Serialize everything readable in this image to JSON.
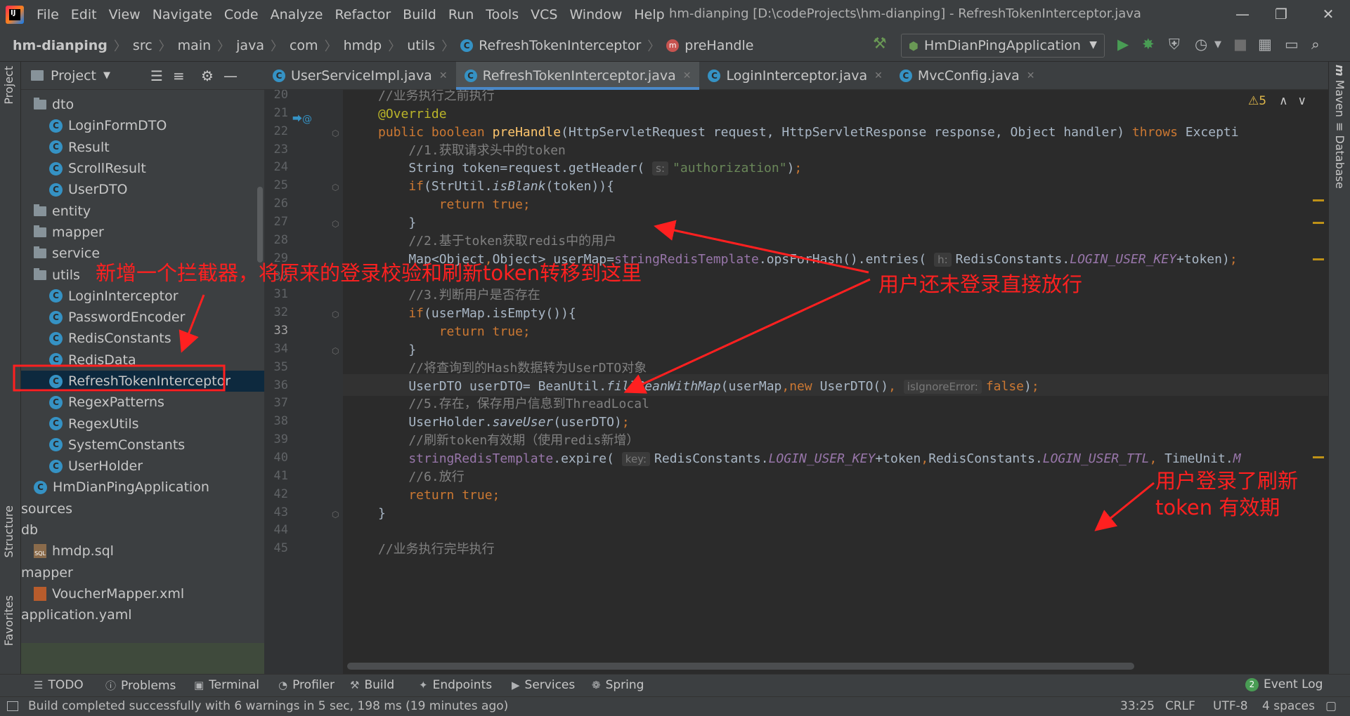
{
  "app": {
    "window_title": "hm-dianping [D:\\codeProjects\\hm-dianping] - RefreshTokenInterceptor.java",
    "logo_text": "IJ"
  },
  "menu": [
    "File",
    "Edit",
    "View",
    "Navigate",
    "Code",
    "Analyze",
    "Refactor",
    "Build",
    "Run",
    "Tools",
    "VCS",
    "Window",
    "Help"
  ],
  "window_controls": {
    "minimize": "—",
    "restore": "❐",
    "close": "✕"
  },
  "breadcrumb": [
    "hm-dianping",
    "src",
    "main",
    "java",
    "com",
    "hmdp",
    "utils",
    "RefreshTokenInterceptor",
    "preHandle"
  ],
  "run_config": {
    "label": "HmDianPingApplication"
  },
  "project_panel": {
    "title": "Project",
    "tree": [
      {
        "type": "folder",
        "label": "dto",
        "indent": 1
      },
      {
        "type": "class",
        "label": "LoginFormDTO",
        "indent": 2
      },
      {
        "type": "class",
        "label": "Result",
        "indent": 2
      },
      {
        "type": "class",
        "label": "ScrollResult",
        "indent": 2
      },
      {
        "type": "class",
        "label": "UserDTO",
        "indent": 2
      },
      {
        "type": "folder",
        "label": "entity",
        "indent": 1
      },
      {
        "type": "folder",
        "label": "mapper",
        "indent": 1
      },
      {
        "type": "folder",
        "label": "service",
        "indent": 1
      },
      {
        "type": "folder",
        "label": "utils",
        "indent": 1
      },
      {
        "type": "class",
        "label": "LoginInterceptor",
        "indent": 2
      },
      {
        "type": "class",
        "label": "PasswordEncoder",
        "indent": 2
      },
      {
        "type": "class",
        "label": "RedisConstants",
        "indent": 2
      },
      {
        "type": "class",
        "label": "RedisData",
        "indent": 2
      },
      {
        "type": "class",
        "label": "RefreshTokenInterceptor",
        "indent": 2,
        "selected": true
      },
      {
        "type": "class",
        "label": "RegexPatterns",
        "indent": 2
      },
      {
        "type": "class",
        "label": "RegexUtils",
        "indent": 2
      },
      {
        "type": "class",
        "label": "SystemConstants",
        "indent": 2
      },
      {
        "type": "class",
        "label": "UserHolder",
        "indent": 2
      },
      {
        "type": "class",
        "label": "HmDianPingApplication",
        "indent": 1
      },
      {
        "type": "text",
        "label": "sources",
        "indent": 0
      },
      {
        "type": "text",
        "label": "db",
        "indent": 0
      },
      {
        "type": "sql",
        "label": "hmdp.sql",
        "indent": 1
      },
      {
        "type": "text",
        "label": "mapper",
        "indent": 0
      },
      {
        "type": "xml",
        "label": "VoucherMapper.xml",
        "indent": 1
      },
      {
        "type": "text",
        "label": "application.yaml",
        "indent": 0
      }
    ]
  },
  "left_strip": {
    "project": "Project",
    "structure": "Structure",
    "favorites": "Favorites"
  },
  "right_strip": {
    "maven": "Maven",
    "database": "Database"
  },
  "tabs": [
    {
      "label": "UserServiceImpl.java",
      "active": false
    },
    {
      "label": "RefreshTokenInterceptor.java",
      "active": true
    },
    {
      "label": "LoginInterceptor.java",
      "active": false
    },
    {
      "label": "MvcConfig.java",
      "active": false
    }
  ],
  "editor": {
    "warnings": "5",
    "current_line": 33,
    "line_numbers": [
      20,
      21,
      22,
      23,
      24,
      25,
      26,
      27,
      28,
      29,
      30,
      31,
      32,
      33,
      34,
      35,
      36,
      37,
      38,
      39,
      40,
      41,
      42,
      43,
      44,
      45
    ]
  },
  "bottom_tools": [
    "TODO",
    "Problems",
    "Terminal",
    "Profiler",
    "Build",
    "Endpoints",
    "Services",
    "Spring"
  ],
  "event_log": {
    "label": "Event Log",
    "count": "2"
  },
  "status": {
    "message": "Build completed successfully with 6 warnings in 5 sec, 198 ms (19 minutes ago)",
    "position": "33:25",
    "line_sep": "CRLF",
    "encoding": "UTF-8",
    "indent": "4 spaces"
  },
  "annotations": {
    "left": "新增一个拦截器，将原来的登录校验和刷新token转移到这里",
    "middle": "用户还未登录直接放行",
    "right_line1": "用户登录了刷新",
    "right_line2": "token 有效期"
  },
  "colors": {
    "annotation": "#ff2020",
    "keyword": "#cc7832",
    "function": "#ffc66d",
    "string": "#6a8759",
    "comment": "#808080",
    "annotation_java": "#bbb529"
  }
}
